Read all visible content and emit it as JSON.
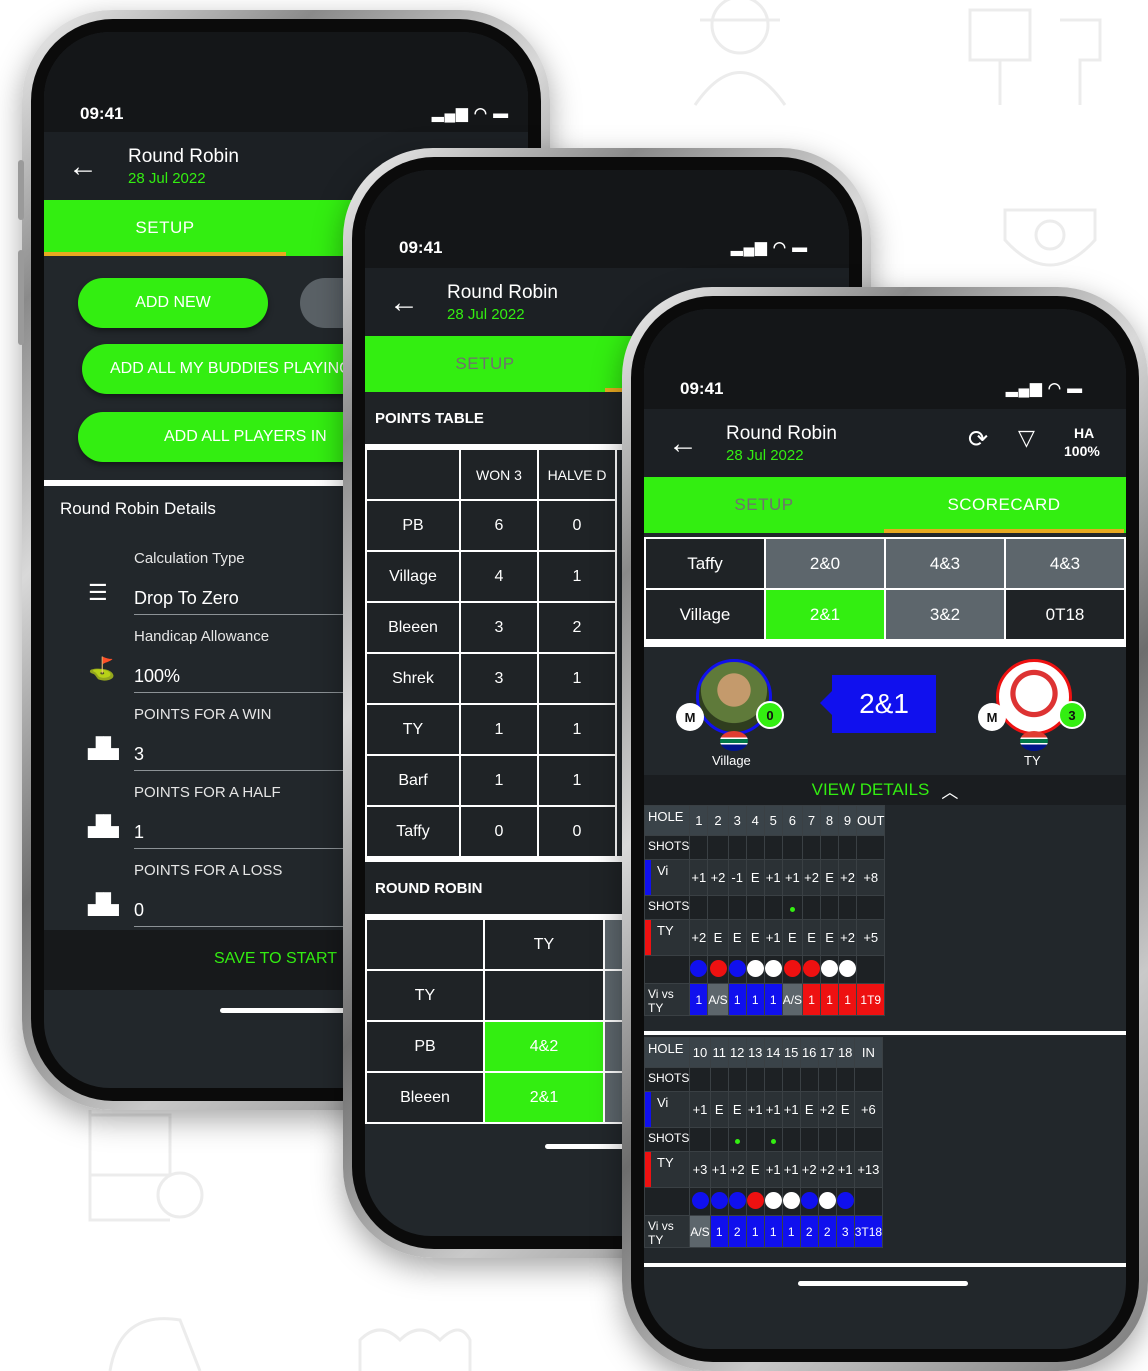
{
  "colors": {
    "accent_green": "#33ee11",
    "blue": "#1010ee",
    "red": "#ee1111",
    "grey": "#5d666c",
    "tab_indicator": "#e8a920"
  },
  "status_time": "09:41",
  "app": {
    "title": "Round Robin",
    "date": "28 Jul 2022"
  },
  "phone1": {
    "tab_setup": "SETUP",
    "add_new": "ADD NEW",
    "add_buddies": "ADD ALL MY BUDDIES PLAYING",
    "add_players": "ADD ALL PLAYERS IN",
    "details_title": "Round Robin Details",
    "fields": [
      {
        "label": "Calculation Type",
        "value": "Drop To Zero",
        "icon": "list-icon"
      },
      {
        "label": "Handicap Allowance",
        "value": "100%",
        "icon": "golfer-icon"
      },
      {
        "label": "POINTS FOR A WIN",
        "value": "3",
        "icon": "podium-icon"
      },
      {
        "label": "POINTS FOR A HALF",
        "value": "1",
        "icon": "podium-icon"
      },
      {
        "label": "POINTS FOR A LOSS",
        "value": "0",
        "icon": "podium-icon"
      }
    ],
    "save": "SAVE TO START"
  },
  "phone2": {
    "tab_setup": "SETUP",
    "points_title": "POINTS TABLE",
    "columns": [
      "WON 3",
      "HALVE D"
    ],
    "rows": [
      {
        "name": "PB",
        "won": "6",
        "halved": "0"
      },
      {
        "name": "Village",
        "won": "4",
        "halved": "1"
      },
      {
        "name": "Bleeen",
        "won": "3",
        "halved": "2"
      },
      {
        "name": "Shrek",
        "won": "3",
        "halved": "1"
      },
      {
        "name": "TY",
        "won": "1",
        "halved": "1"
      },
      {
        "name": "Barf",
        "won": "1",
        "halved": "1"
      },
      {
        "name": "Taffy",
        "won": "0",
        "halved": "0"
      }
    ],
    "rr_title": "ROUND ROBIN",
    "rr_col": "TY",
    "rr_rows": [
      {
        "name": "TY",
        "value": ""
      },
      {
        "name": "PB",
        "value": "4&2"
      },
      {
        "name": "Bleeen",
        "value": "2&1"
      }
    ]
  },
  "phone3": {
    "ha_label": "HA",
    "ha_value": "100%",
    "tab_setup": "SETUP",
    "tab_scorecard": "SCORECARD",
    "summary": [
      {
        "name": "Taffy",
        "cells": [
          "2&0",
          "4&3",
          "4&3"
        ]
      },
      {
        "name": "Village",
        "cells": [
          "2&1",
          "3&2",
          "0T18"
        ]
      }
    ],
    "match": {
      "left_player": "Village",
      "right_player": "TY",
      "result": "2&1",
      "left_badge": "M",
      "right_badge": "M",
      "left_score": "0",
      "right_score": "3"
    },
    "view_details": "VIEW DETAILS",
    "front": {
      "hole_label": "HOLE",
      "holes": [
        "1",
        "2",
        "3",
        "4",
        "5",
        "6",
        "7",
        "8",
        "9"
      ],
      "total_label": "OUT",
      "shots_label": "SHOTS",
      "p1": "Vi",
      "p1_scores": [
        "+1",
        "+2",
        "-1",
        "E",
        "+1",
        "+1",
        "+2",
        "E",
        "+2"
      ],
      "p1_total": "+8",
      "p2": "TY",
      "p2_scores": [
        "+2",
        "E",
        "E",
        "E",
        "+1",
        "E",
        "E",
        "E",
        "+2"
      ],
      "p2_total": "+5",
      "dots": [
        "blue",
        "red",
        "blue",
        "white",
        "white",
        "red",
        "red",
        "white",
        "white"
      ],
      "vs_label": "Vi vs TY",
      "vs": [
        "1",
        "A/S",
        "1",
        "1",
        "1",
        "A/S",
        "1",
        "1",
        "1"
      ],
      "vs_colors": [
        "blue",
        "grey",
        "blue",
        "blue",
        "blue",
        "grey",
        "red",
        "red",
        "red"
      ],
      "vs_total": "1T9",
      "vs_total_color": "red"
    },
    "back": {
      "hole_label": "HOLE",
      "holes": [
        "10",
        "11",
        "12",
        "13",
        "14",
        "15",
        "16",
        "17",
        "18"
      ],
      "total_label": "IN",
      "shots_label": "SHOTS",
      "p1": "Vi",
      "p1_scores": [
        "+1",
        "E",
        "E",
        "+1",
        "+1",
        "+1",
        "E",
        "+2",
        "E"
      ],
      "p1_total": "+6",
      "p2": "TY",
      "p2_scores": [
        "+3",
        "+1",
        "+2",
        "E",
        "+1",
        "+1",
        "+2",
        "+2",
        "+1"
      ],
      "p2_total": "+13",
      "dots": [
        "blue",
        "blue",
        "blue",
        "red",
        "white",
        "white",
        "blue",
        "white",
        "blue"
      ],
      "vs_label": "Vi vs TY",
      "vs": [
        "A/S",
        "1",
        "2",
        "1",
        "1",
        "1",
        "2",
        "2",
        "3"
      ],
      "vs_colors": [
        "grey",
        "blue",
        "blue",
        "blue",
        "blue",
        "blue",
        "blue",
        "blue",
        "blue"
      ],
      "vs_total": "3T18",
      "vs_total_color": "blue"
    }
  }
}
